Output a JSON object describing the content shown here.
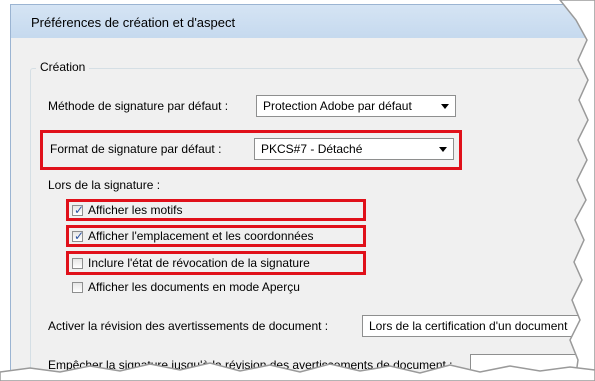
{
  "window": {
    "title": "Préférences de création et d'aspect"
  },
  "group": {
    "legend": "Création"
  },
  "signing_method": {
    "label": "Méthode de signature par défaut :",
    "value": "Protection Adobe par défaut"
  },
  "signing_format": {
    "label": "Format de signature par défaut :",
    "value": "PKCS#7 - Détaché"
  },
  "on_signing": {
    "label": "Lors de la signature :",
    "checkboxes": [
      {
        "label": "Afficher les motifs",
        "checked": true
      },
      {
        "label": "Afficher l'emplacement et les coordonnées",
        "checked": true
      },
      {
        "label": "Inclure l'état de révocation de la signature",
        "checked": false
      },
      {
        "label": "Afficher les documents en mode Aperçu",
        "checked": false
      }
    ]
  },
  "warnings_review": {
    "label": "Activer la révision des avertissements de document :",
    "value": "Lors de la certification d'un document"
  },
  "prevent_signing": {
    "label": "Empêcher la signature jusqu'à la révision des avertissements de document :"
  },
  "colors": {
    "highlight": "#e0101a",
    "check": "#2e56a4",
    "dialog_bg": "#f0f0f0"
  }
}
